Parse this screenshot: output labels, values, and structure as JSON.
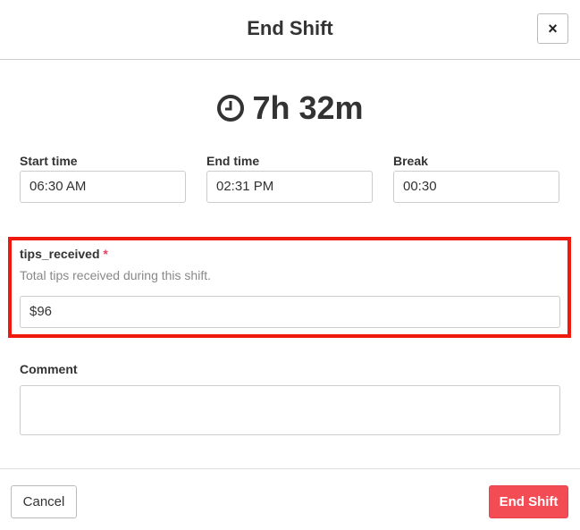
{
  "header": {
    "title": "End Shift",
    "close_label": "×"
  },
  "duration": "7h 32m",
  "fields": {
    "start_time": {
      "label": "Start time",
      "value": "06:30 AM"
    },
    "end_time": {
      "label": "End time",
      "value": "02:31 PM"
    },
    "break": {
      "label": "Break",
      "value": "00:30"
    },
    "tips": {
      "label": "tips_received",
      "required_marker": "*",
      "help": "Total tips received during this shift.",
      "value": "$96"
    },
    "comment": {
      "label": "Comment",
      "value": ""
    }
  },
  "footer": {
    "cancel": "Cancel",
    "end_shift": "End Shift"
  },
  "colors": {
    "highlight": "#f0190e",
    "primary": "#f44c55"
  }
}
